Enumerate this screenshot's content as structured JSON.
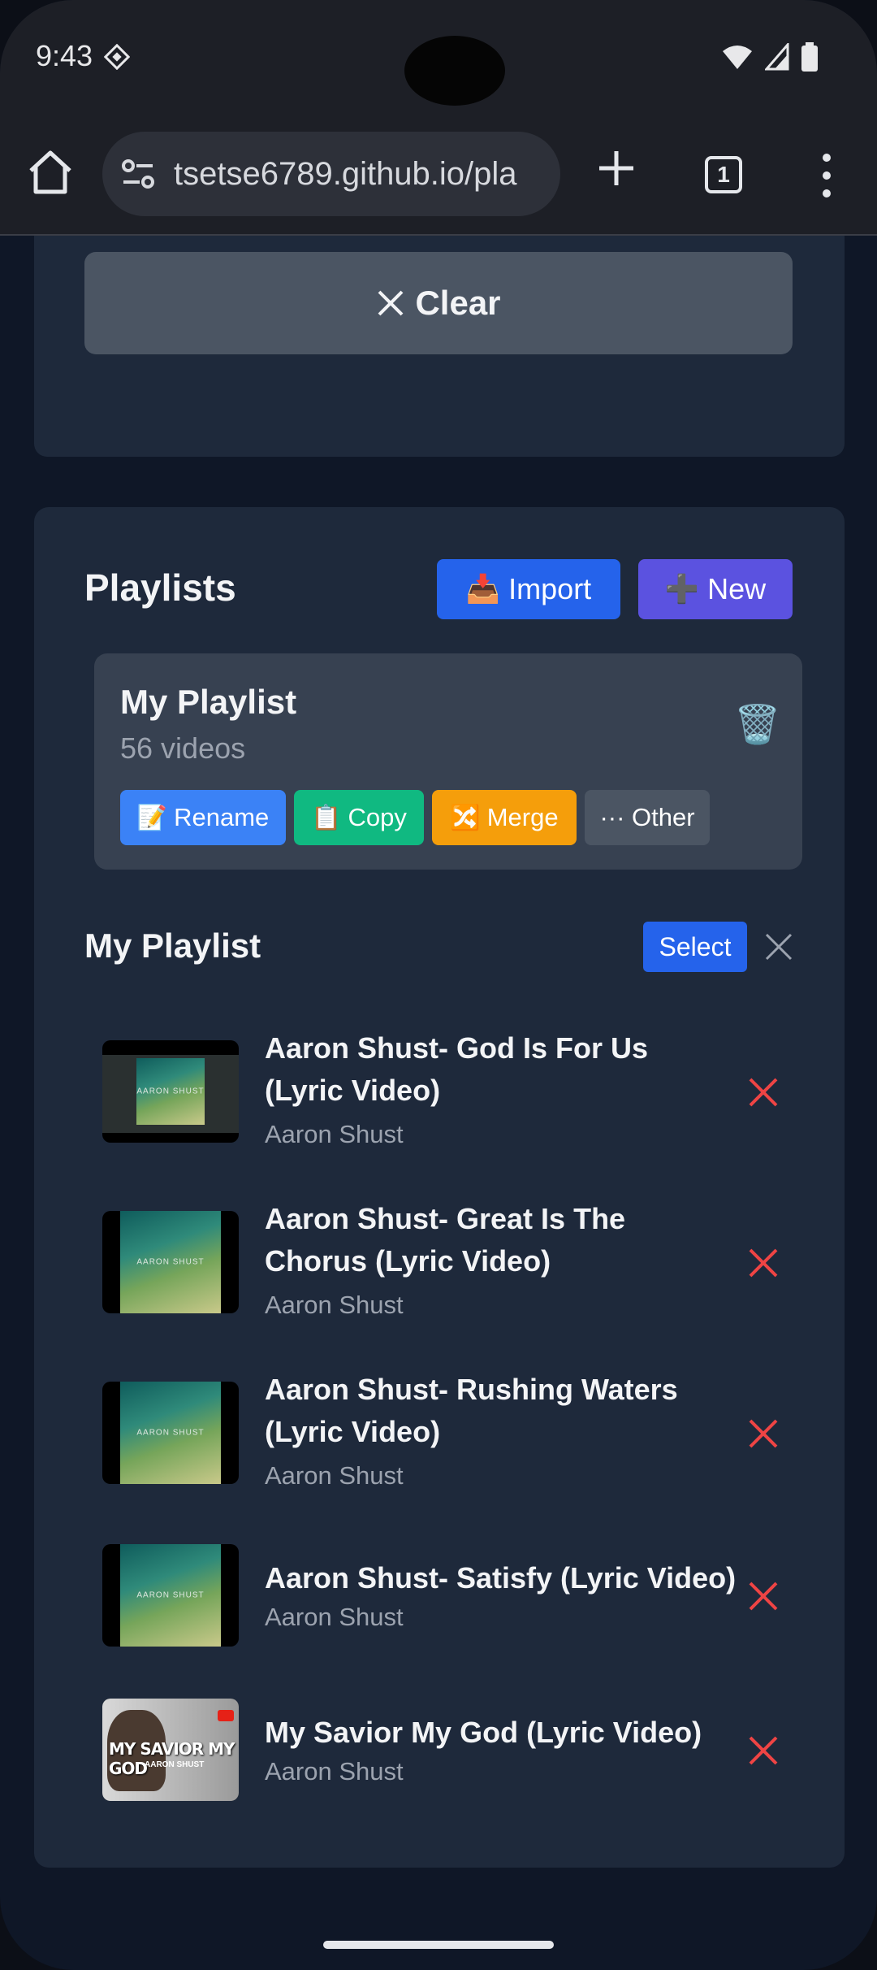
{
  "status": {
    "time": "9:43"
  },
  "browser": {
    "url": "tsetse6789.github.io/pla",
    "tab_count": "1"
  },
  "actions": {
    "clear_label": "Clear"
  },
  "playlists": {
    "heading": "Playlists",
    "import_label": "Import",
    "import_icon": "📥",
    "new_label": "New",
    "new_icon": "➕",
    "card": {
      "name": "My Playlist",
      "count": "56 videos",
      "trash_icon": "🗑️",
      "rename_label": "Rename",
      "rename_icon": "📝",
      "copy_label": "Copy",
      "copy_icon": "📋",
      "merge_label": "Merge",
      "merge_icon": "🔀",
      "other_label": "··· Other"
    }
  },
  "current_list": {
    "title": "My Playlist",
    "select_label": "Select",
    "videos": [
      {
        "title": "Aaron Shust- God Is For Us (Lyric Video)",
        "artist": "Aaron Shust"
      },
      {
        "title": "Aaron Shust- Great Is The Chorus (Lyric Video)",
        "artist": "Aaron Shust"
      },
      {
        "title": "Aaron Shust- Rushing Waters (Lyric Video)",
        "artist": "Aaron Shust"
      },
      {
        "title": "Aaron Shust- Satisfy (Lyric Video)",
        "artist": "Aaron Shust"
      },
      {
        "title": "My Savior My God (Lyric Video)",
        "artist": "Aaron Shust"
      }
    ],
    "thumb_label": "AARON SHUST",
    "savior_thumb_title": "MY SAVIOR MY GOD",
    "savior_thumb_sub": "AARON SHUST"
  },
  "colors": {
    "accent_blue": "#2563eb",
    "accent_indigo": "#5b52e0",
    "remove_red": "#ef4444",
    "card_bg": "#1e293b"
  }
}
